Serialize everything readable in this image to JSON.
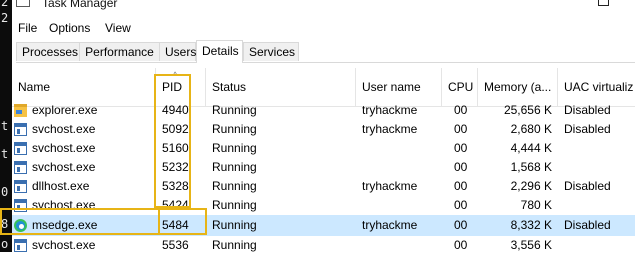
{
  "window": {
    "title": "Task Manager"
  },
  "terminal_chars": [
    "2",
    "2",
    "t",
    "t",
    "0",
    "8",
    "o"
  ],
  "menu": [
    "File",
    "Options",
    "View"
  ],
  "tabs": [
    "Processes",
    "Performance",
    "Users",
    "Details",
    "Services"
  ],
  "active_tab": "Details",
  "columns": {
    "name": "Name",
    "pid": "PID",
    "status": "Status",
    "user": "User name",
    "cpu": "CPU",
    "memory": "Memory (a...",
    "uac": "UAC virtualiz"
  },
  "sort_indicator": "^",
  "processes": [
    {
      "name": "explorer.exe",
      "icon": "folder-icon",
      "pid": "4940",
      "status": "Running",
      "user": "tryhackme",
      "cpu": "00",
      "memory": "25,656 K",
      "uac": "Disabled"
    },
    {
      "name": "svchost.exe",
      "icon": "service-icon",
      "pid": "5092",
      "status": "Running",
      "user": "tryhackme",
      "cpu": "00",
      "memory": "2,680 K",
      "uac": "Disabled"
    },
    {
      "name": "svchost.exe",
      "icon": "service-icon",
      "pid": "5160",
      "status": "Running",
      "user": "",
      "cpu": "00",
      "memory": "4,444 K",
      "uac": ""
    },
    {
      "name": "svchost.exe",
      "icon": "service-icon",
      "pid": "5232",
      "status": "Running",
      "user": "",
      "cpu": "00",
      "memory": "1,568 K",
      "uac": ""
    },
    {
      "name": "dllhost.exe",
      "icon": "service-icon",
      "pid": "5328",
      "status": "Running",
      "user": "tryhackme",
      "cpu": "00",
      "memory": "2,296 K",
      "uac": "Disabled"
    },
    {
      "name": "svchost.exe",
      "icon": "service-icon",
      "pid": "5424",
      "status": "Running",
      "user": "",
      "cpu": "00",
      "memory": "780 K",
      "uac": ""
    },
    {
      "name": "msedge.exe",
      "icon": "edge-icon",
      "pid": "5484",
      "status": "Running",
      "user": "tryhackme",
      "cpu": "00",
      "memory": "8,332 K",
      "uac": "Disabled",
      "selected": true
    },
    {
      "name": "svchost.exe",
      "icon": "service-icon",
      "pid": "5536",
      "status": "Running",
      "user": "",
      "cpu": "00",
      "memory": "3,556 K",
      "uac": ""
    }
  ],
  "colors": {
    "selected_row": "#cce8ff",
    "highlight": "#e7b416"
  }
}
